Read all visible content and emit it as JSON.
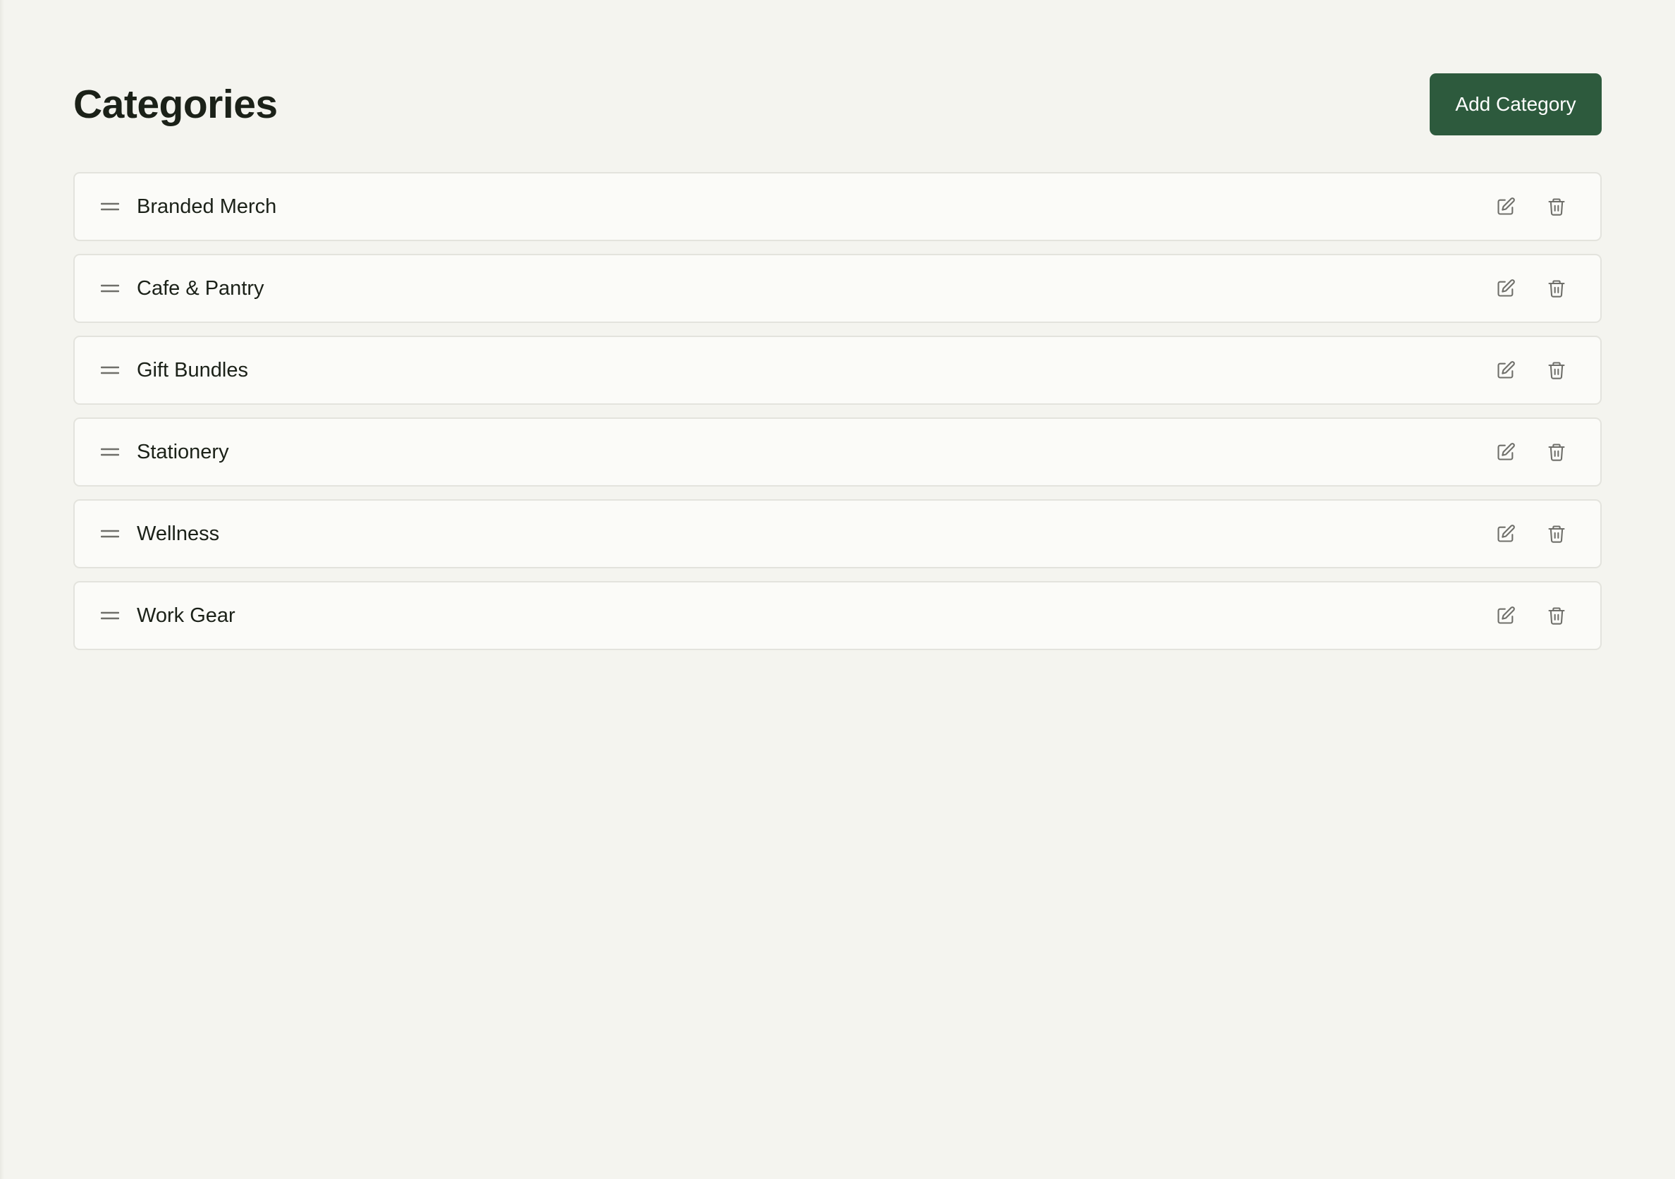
{
  "header": {
    "title": "Categories",
    "add_button_label": "Add Category"
  },
  "categories": [
    {
      "label": "Branded Merch"
    },
    {
      "label": "Cafe & Pantry"
    },
    {
      "label": "Gift Bundles"
    },
    {
      "label": "Stationery"
    },
    {
      "label": "Wellness"
    },
    {
      "label": "Work Gear"
    }
  ],
  "icons": {
    "drag": "drag-handle-icon",
    "edit": "edit-icon",
    "delete": "trash-icon"
  },
  "colors": {
    "accent": "#2d5a3d",
    "background": "#f4f4ef",
    "row_background": "#fbfbf8",
    "icon": "#6f6f6a"
  }
}
